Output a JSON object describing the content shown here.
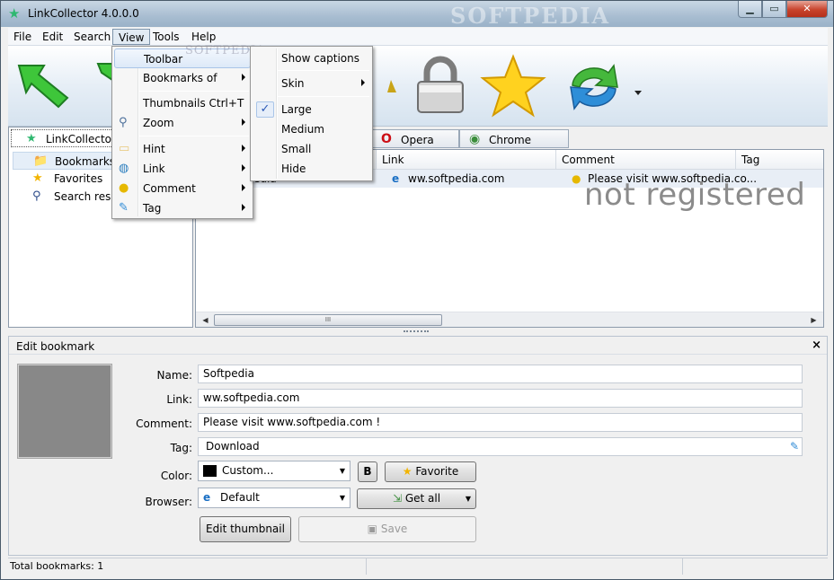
{
  "window": {
    "title": "LinkCollector 4.0.0.0",
    "watermark": "SOFTPEDIA",
    "min_glyph": "▁",
    "max_glyph": "▭",
    "close_glyph": "✕"
  },
  "menubar": [
    "File",
    "Edit",
    "Search",
    "View",
    "Tools",
    "Help"
  ],
  "toolbar": {
    "icons": [
      "import-arrow-icon",
      "export-arrow-icon",
      "lock-icon",
      "favorite-star-icon",
      "sync-arrows-icon"
    ]
  },
  "tree": {
    "root": "LinkCollector",
    "items": [
      {
        "label": "Bookmarks",
        "icon": "folder-icon",
        "glyph": "📁"
      },
      {
        "label": "Favorites",
        "icon": "star-icon",
        "glyph": "★"
      },
      {
        "label": "Search result",
        "icon": "binoculars-icon",
        "glyph": "⚲"
      }
    ]
  },
  "browser_tabs": [
    {
      "label": "Opera",
      "icon": "opera-icon",
      "glyph": "O",
      "color": "#cc0f16"
    },
    {
      "label": "Chrome",
      "icon": "chrome-icon",
      "glyph": "◉",
      "color": "#3b8e3b"
    }
  ],
  "grid": {
    "columns": [
      "Link",
      "Comment",
      "Tag"
    ],
    "row": {
      "name_fragment": "edia",
      "link": "ww.softpedia.com",
      "comment": "Please visit www.softpedia.co..."
    },
    "overlay": "not registered",
    "scroll_grip": "III"
  },
  "view_menu": {
    "items": [
      {
        "label": "Toolbar",
        "submenu": false
      },
      {
        "label": "Bookmarks of",
        "submenu": true
      },
      {
        "label": "Thumbnails Ctrl+T",
        "submenu": false
      },
      {
        "label": "Zoom",
        "submenu": true
      },
      {
        "label": "Hint",
        "submenu": true
      },
      {
        "label": "Link",
        "submenu": true
      },
      {
        "label": "Comment",
        "submenu": true
      },
      {
        "label": "Tag",
        "submenu": true
      }
    ],
    "ghost": "SOFTPEDIA"
  },
  "toolbar_submenu": {
    "items": [
      "Show captions",
      "Skin",
      "Large",
      "Medium",
      "Small",
      "Hide"
    ],
    "checked": "Large",
    "check_glyph": "✓"
  },
  "edit": {
    "title": "Edit bookmark",
    "close_glyph": "×",
    "labels": {
      "name": "Name:",
      "link": "Link:",
      "comment": "Comment:",
      "tag": "Tag:",
      "color": "Color:",
      "browser": "Browser:"
    },
    "name": "Softpedia",
    "link": "ww.softpedia.com",
    "comment": "Please visit www.softpedia.com !",
    "tag": "Download",
    "color_value": "Custom...",
    "color_swatch": "#000000",
    "bold_label": "B",
    "favorite_label": "Favorite",
    "browser_value": "Default",
    "getall_label": "Get all",
    "edit_thumb_label": "Edit thumbnail",
    "save_label": "Save"
  },
  "status": {
    "text": "Total bookmarks: 1"
  }
}
